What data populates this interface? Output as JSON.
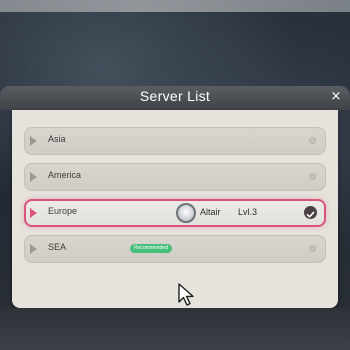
{
  "dialog": {
    "title": "Server List",
    "close_label": "×"
  },
  "servers": [
    {
      "name": "Asia",
      "selected": false,
      "badge": ""
    },
    {
      "name": "America",
      "selected": false,
      "badge": ""
    },
    {
      "name": "Europe",
      "selected": true,
      "badge": "",
      "character": {
        "name": "Altair",
        "level": "Lvl.3"
      }
    },
    {
      "name": "SEA",
      "selected": false,
      "badge": "Recommended"
    }
  ],
  "colors": {
    "selected_accent": "#d9537e",
    "badge_green": "#49c07a",
    "panel_bg": "#e6e3dc",
    "header_bg": "#4a4e53"
  },
  "icons": {
    "close": "close-icon",
    "flag": "flag-icon",
    "check": "check-icon",
    "status": "status-dot-icon",
    "avatar": "character-avatar",
    "cursor": "mouse-cursor-icon"
  }
}
